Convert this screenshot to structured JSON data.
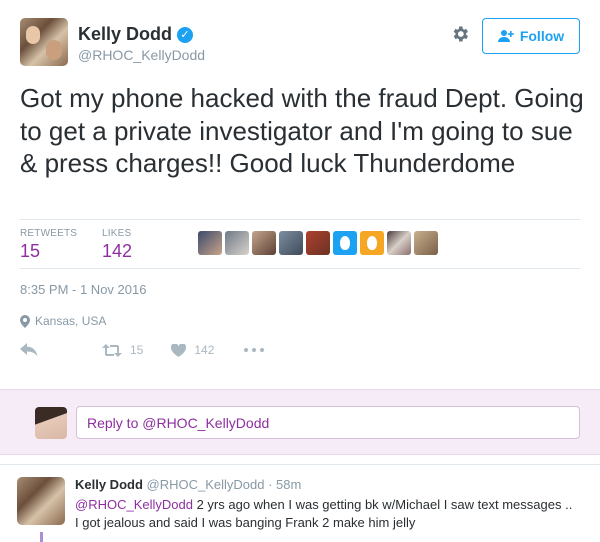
{
  "author": {
    "display_name": "Kelly Dodd",
    "handle": "@RHOC_KellyDodd",
    "verified_glyph": "✓"
  },
  "header": {
    "follow_label": "Follow",
    "gear_icon": "gear-icon",
    "follow_icon": "add-user-icon"
  },
  "tweet": {
    "text": "Got my phone hacked with the fraud Dept. Going to get a private investigator and I'm going to sue & press charges!! Good luck Thunderdome"
  },
  "stats": {
    "retweets_label": "RETWEETS",
    "retweets_value": "15",
    "likes_label": "LIKES",
    "likes_value": "142"
  },
  "timestamp": "8:35 PM - 1 Nov 2016",
  "location": {
    "text": "Kansas, USA",
    "icon": "location-pin-icon"
  },
  "actions": {
    "retweet_count": "15",
    "like_count": "142"
  },
  "reply_box": {
    "placeholder": "Reply to @RHOC_KellyDodd"
  },
  "reply_tweet": {
    "name": "Kelly Dodd",
    "meta": "@RHOC_KellyDodd · 58m",
    "mention": "@RHOC_KellyDodd",
    "text": " 2 yrs ago when I was getting bk w/Michael I saw text messages .. I got jealous and said I was banging Frank 2 make him jelly"
  },
  "colors": {
    "accent": "#8e2fa1",
    "link_blue": "#1da1f2",
    "muted": "#8899a6",
    "reply_bg": "#f5ecf7"
  }
}
